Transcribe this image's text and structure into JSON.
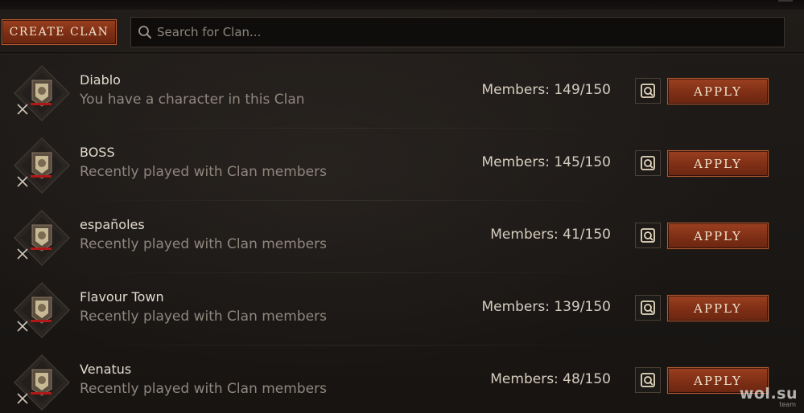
{
  "toolbar": {
    "create_clan_label": "CREATE CLAN",
    "search_placeholder": "Search for Clan..."
  },
  "clans": [
    {
      "name": "Diablo",
      "status": "You have a character in this Clan",
      "members": "Members: 149/150",
      "apply_label": "APPLY"
    },
    {
      "name": "BOSS",
      "status": "Recently played with Clan members",
      "members": "Members: 145/150",
      "apply_label": "APPLY"
    },
    {
      "name": "españoles",
      "status": "Recently played with Clan members",
      "members": "Members: 41/150",
      "apply_label": "APPLY"
    },
    {
      "name": "Flavour Town",
      "status": "Recently played with Clan members",
      "members": "Members: 139/150",
      "apply_label": "APPLY"
    },
    {
      "name": "Venatus",
      "status": "Recently played with Clan members",
      "members": "Members: 48/150",
      "apply_label": "APPLY"
    }
  ],
  "icons": {
    "search": "search-icon",
    "emblem": "clan-emblem-icon",
    "crossed_swords": "crossed-swords-icon",
    "info": "clan-info-icon"
  },
  "colors": {
    "accent_button": "#7e2f15",
    "background": "#1b1816",
    "name_text": "#e2dacd",
    "status_text": "#8f877d"
  },
  "watermark": {
    "main": "wol.su",
    "sub": "team"
  }
}
